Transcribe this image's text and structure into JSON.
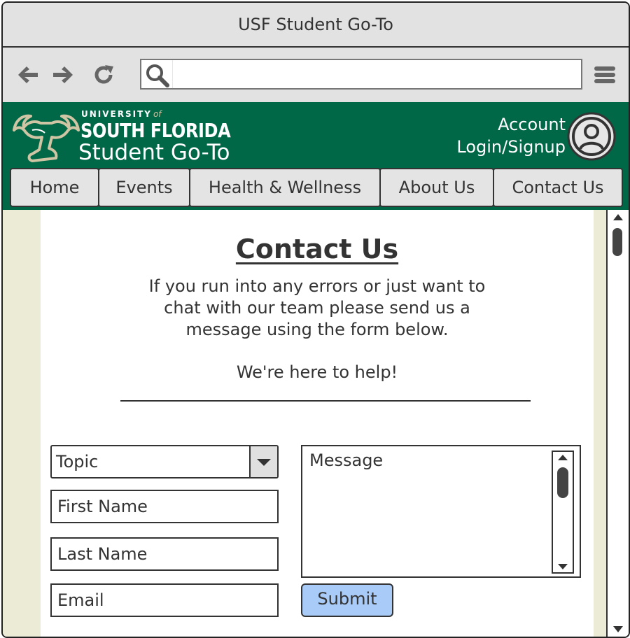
{
  "window": {
    "title": "USF Student Go-To"
  },
  "toolbar": {
    "back_icon": "arrow-left",
    "forward_icon": "arrow-right",
    "reload_icon": "refresh",
    "menu_icon": "hamburger",
    "url_value": ""
  },
  "header": {
    "brand_university": "UNIVERSITY",
    "brand_of": "of",
    "brand_name": "SOUTH FLORIDA",
    "brand_sub": "Student Go-To",
    "account_line1": "Account",
    "account_line2": "Login/Signup",
    "colors": {
      "green": "#006747",
      "gold": "#cfc4a3"
    }
  },
  "nav": {
    "items": [
      {
        "label": "Home"
      },
      {
        "label": "Events"
      },
      {
        "label": "Health & Wellness"
      },
      {
        "label": "About Us"
      },
      {
        "label": "Contact Us"
      }
    ]
  },
  "main": {
    "title": "Contact Us",
    "intro": [
      "If you run into any errors or just want to",
      "chat with our team please send us a",
      "message using the form below."
    ],
    "help_text": "We're here to help!",
    "form": {
      "topic_value": "Topic",
      "first_name_placeholder": "First Name",
      "last_name_placeholder": "Last Name",
      "email_placeholder": "Email",
      "message_placeholder": "Message",
      "submit_label": "Submit"
    },
    "colors": {
      "side_band": "#ecebd5",
      "submit_bg": "#a9cbf7"
    }
  }
}
